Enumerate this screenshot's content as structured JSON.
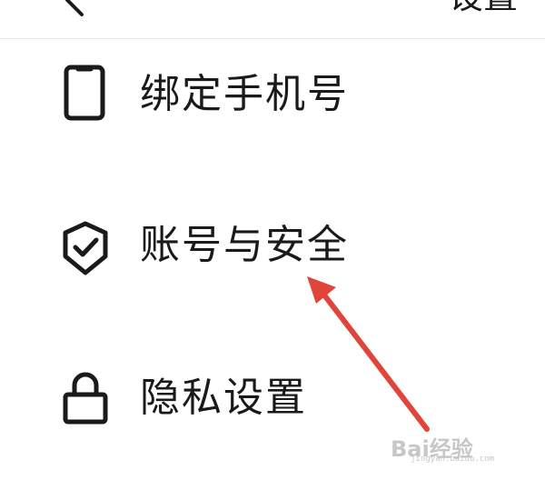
{
  "header": {
    "back_icon": "chevron-left-icon",
    "title_fragment": "设置"
  },
  "menu": {
    "items": [
      {
        "label": "绑定手机号",
        "icon": "phone-icon"
      },
      {
        "label": "账号与安全",
        "icon": "shield-check-icon"
      },
      {
        "label": "隐私设置",
        "icon": "lock-icon"
      }
    ]
  },
  "annotation": {
    "arrow_color": "#e0443a"
  },
  "watermark": {
    "logo_text": "Bai经验",
    "url_text": "jingyan.baidu.com"
  }
}
